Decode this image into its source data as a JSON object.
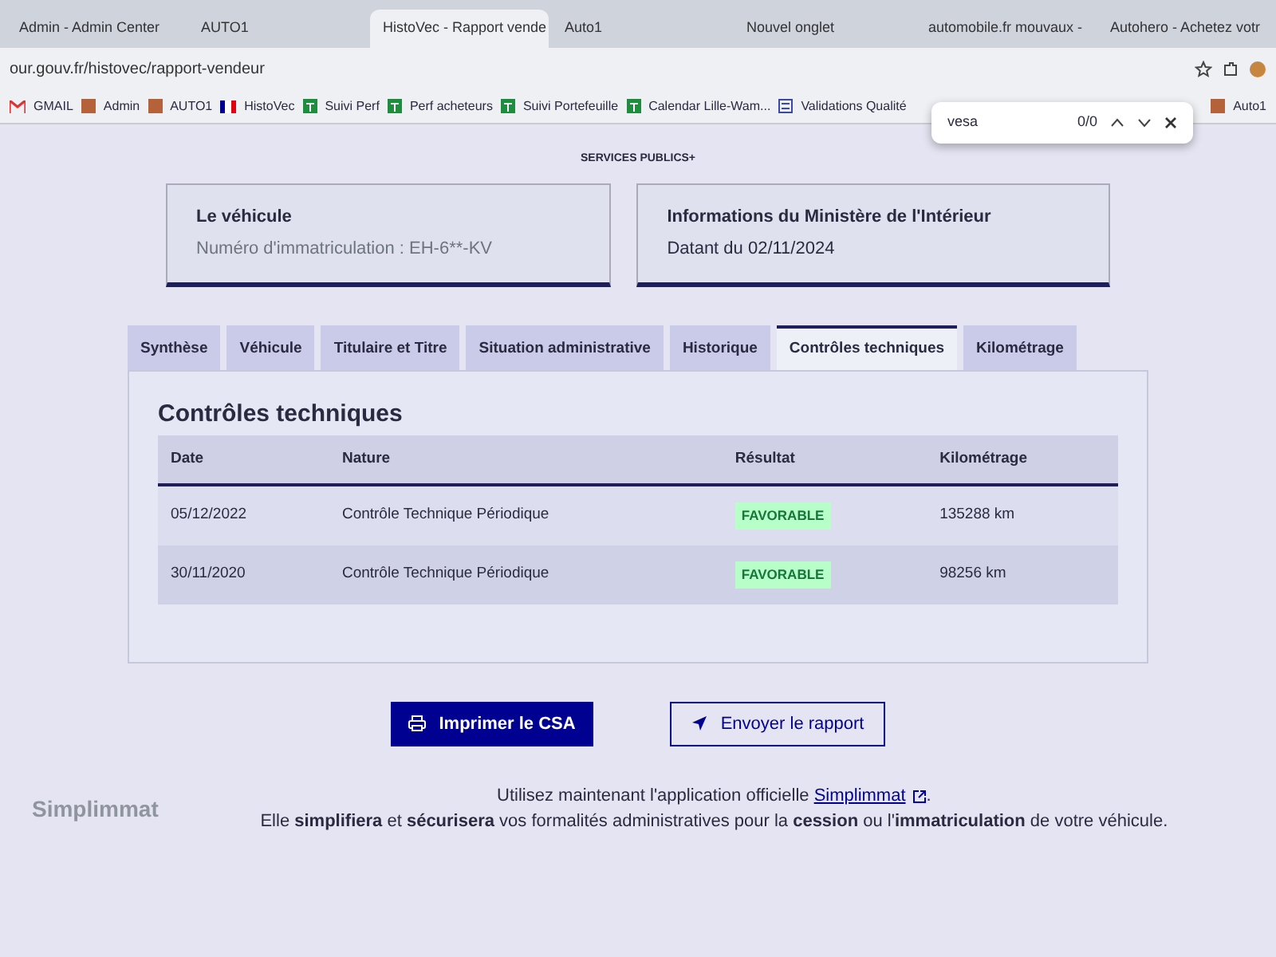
{
  "browser": {
    "tabs": [
      {
        "title": "Admin - Admin Center",
        "selected": false
      },
      {
        "title": "AUTO1",
        "selected": false
      },
      {
        "title": "HistoVec - Rapport vende",
        "selected": true
      },
      {
        "title": "Auto1",
        "selected": false
      },
      {
        "title": "Nouvel onglet",
        "selected": false
      },
      {
        "title": "automobile.fr mouvaux -",
        "selected": false
      },
      {
        "title": "Autohero - Achetez votr",
        "selected": false
      }
    ],
    "address": "our.gouv.fr/histovec/rapport-vendeur",
    "bookmarks": [
      {
        "label": "GMAIL",
        "kind": "mail"
      },
      {
        "label": "Admin",
        "kind": "square"
      },
      {
        "label": "AUTO1",
        "kind": "square"
      },
      {
        "label": "HistoVec",
        "kind": "flag"
      },
      {
        "label": "Suivi Perf",
        "kind": "sheet"
      },
      {
        "label": "Perf acheteurs",
        "kind": "sheet"
      },
      {
        "label": "Suivi Portefeuille",
        "kind": "sheet"
      },
      {
        "label": "Calendar Lille-Wam...",
        "kind": "sheet"
      },
      {
        "label": "Validations Qualité",
        "kind": "form"
      }
    ],
    "bookmarks_right": [
      {
        "label": "Auto1",
        "kind": "square"
      }
    ],
    "find_bar": {
      "query": "vesa",
      "count": "0/0"
    }
  },
  "page": {
    "brand": "SERVICES PUBLICS+",
    "vehicle_card": {
      "title": "Le véhicule",
      "plate": "Numéro d'immatriculation : EH-6**-KV"
    },
    "ministry_card": {
      "title": "Informations du Ministère de l'Intérieur",
      "date": "Datant du 02/11/2024"
    },
    "tabs": [
      {
        "label": "Synthèse",
        "selected": false
      },
      {
        "label": "Véhicule",
        "selected": false
      },
      {
        "label": "Titulaire et Titre",
        "selected": false
      },
      {
        "label": "Situation administrative",
        "selected": false
      },
      {
        "label": "Historique",
        "selected": false
      },
      {
        "label": "Contrôles techniques",
        "selected": true
      },
      {
        "label": "Kilométrage",
        "selected": false
      }
    ],
    "section_title": "Contrôles techniques",
    "table": {
      "columns": [
        "Date",
        "Nature",
        "Résultat",
        "Kilométrage"
      ],
      "rows": [
        {
          "date": "05/12/2022",
          "nature": "Contrôle Technique Périodique",
          "result": "FAVORABLE",
          "mileage": "135288 km"
        },
        {
          "date": "30/11/2020",
          "nature": "Contrôle Technique Périodique",
          "result": "FAVORABLE",
          "mileage": "98256 km"
        }
      ]
    },
    "buttons": [
      {
        "label": "Imprimer le CSA",
        "kind": "primary"
      },
      {
        "label": "Envoyer le rapport",
        "kind": "secondary"
      }
    ],
    "logo": "Simplimmat",
    "notice": {
      "before": "Utilisez maintenant l'application officielle ",
      "link": "Simplimmat",
      "after": ".",
      "body": "Elle **simplifiera** et **sécurisera** vos formalités administratives pour la **cession** ou l'**immatriculation** de votre véhicule."
    }
  }
}
